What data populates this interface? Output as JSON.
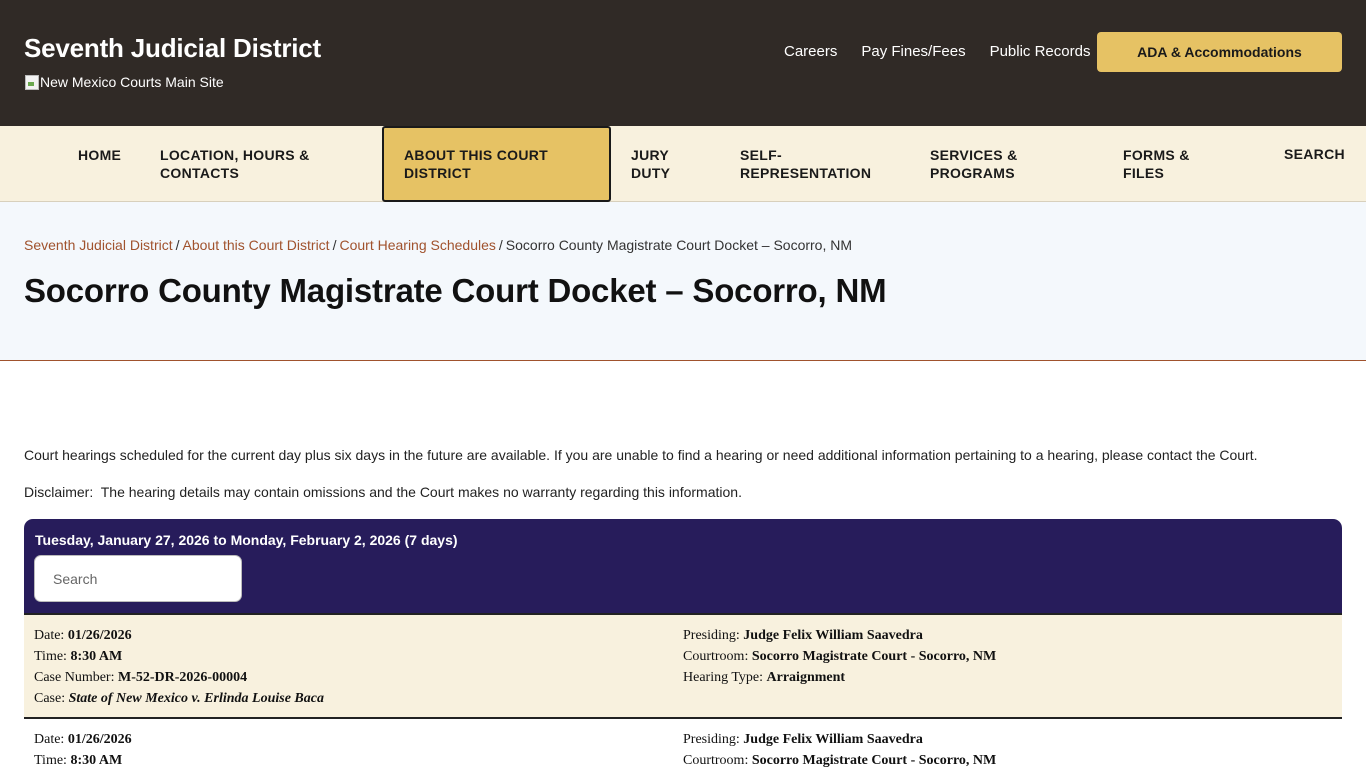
{
  "header": {
    "site_title": "Seventh Judicial District",
    "main_site_alt": "New Mexico Courts Main Site",
    "links": [
      "Careers",
      "Pay Fines/Fees",
      "Public Records"
    ],
    "ada_button": "ADA & Accommodations"
  },
  "nav": {
    "home": "HOME",
    "location_1": "LOCATION, HOURS &",
    "location_2": "CONTACTS",
    "about_1": "ABOUT THIS COURT",
    "about_2": "DISTRICT",
    "jury_1": "JURY",
    "jury_2": "DUTY",
    "self_1": "SELF-",
    "self_2": "REPRESENTATION",
    "services_1": "SERVICES &",
    "services_2": "PROGRAMS",
    "forms_1": "FORMS &",
    "forms_2": "FILES",
    "search": "SEARCH"
  },
  "breadcrumb": {
    "items": [
      "Seventh Judicial District",
      "About this Court District",
      "Court Hearing Schedules"
    ],
    "current": "Socorro County Magistrate Court Docket – Socorro, NM",
    "separator": "/"
  },
  "page_title": "Socorro County Magistrate Court Docket – Socorro, NM",
  "content": {
    "intro": "Court hearings scheduled for the current day plus six days in the future are available. If you are unable to find a hearing or need additional information pertaining to a hearing, please contact the Court.",
    "disclaimer": "Disclaimer:  The hearing details may contain omissions and the Court makes no warranty regarding this information."
  },
  "docket": {
    "range": "Tuesday, January 27, 2026 to Monday, February 2, 2026 (7 days)",
    "search_placeholder": "Search",
    "labels": {
      "date": "Date:",
      "time": "Time:",
      "case_number": "Case Number:",
      "case": "Case:",
      "presiding": "Presiding:",
      "courtroom": "Courtroom:",
      "hearing_type": "Hearing Type:"
    },
    "records": [
      {
        "date": "01/26/2026",
        "time": "8:30 AM",
        "case_number": "M-52-DR-2026-00004",
        "case": "State of New Mexico v. Erlinda Louise Baca",
        "presiding": "Judge Felix William Saavedra",
        "courtroom": "Socorro Magistrate Court - Socorro, NM",
        "hearing_type": "Arraignment"
      },
      {
        "date": "01/26/2026",
        "time": "8:30 AM",
        "presiding": "Judge Felix William Saavedra",
        "courtroom": "Socorro Magistrate Court - Socorro, NM"
      }
    ]
  }
}
